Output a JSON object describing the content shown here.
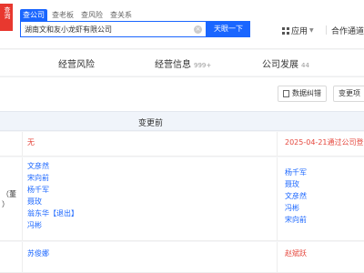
{
  "logo": {
    "text": "查询"
  },
  "search": {
    "tabs": [
      "查公司",
      "查老板",
      "查风险",
      "查关系"
    ],
    "value": "湖南文和友小龙虾有限公司",
    "clear": "×",
    "button": "天眼一下"
  },
  "header_menu": {
    "app": "应用",
    "app_caret": "▼",
    "coop": "合作通道"
  },
  "nav_tabs": [
    {
      "label": "经营风险",
      "count": ""
    },
    {
      "label": "经营信息",
      "count": "999+"
    },
    {
      "label": "公司发展",
      "count": "44"
    }
  ],
  "toolbar": {
    "data_correction": "数据纠错",
    "change_items": "变更项"
  },
  "table": {
    "header_before": "变更前",
    "row1": {
      "before": "无",
      "after": "2025-04-21通过公司登"
    },
    "row2": {
      "side_label": "（董\n）",
      "before": [
        "文彦然",
        "宋向前",
        "杨千军",
        "聂玫",
        "翁东华",
        "冯彬"
      ],
      "exit_label": "【退出】",
      "after": [
        "杨千军",
        "聂玫",
        "文彦然",
        "冯彬",
        "宋向前"
      ]
    },
    "row3": {
      "before": "苏俊娜",
      "after": "赵斌跃"
    }
  },
  "colors": {
    "accent": "#1a66ff",
    "danger": "#e5473d",
    "brand": "#e8382f"
  }
}
